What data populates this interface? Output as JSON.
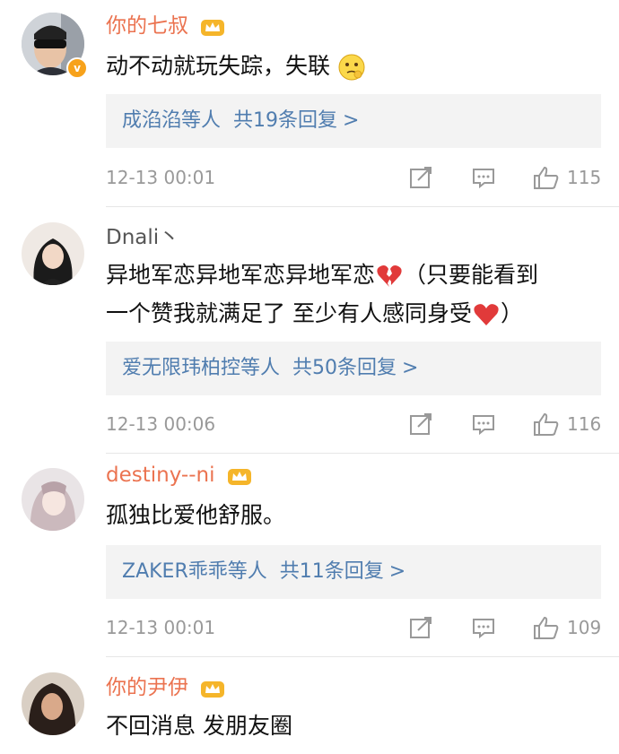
{
  "comments": [
    {
      "username": "你的七叔",
      "verified": true,
      "crown": true,
      "text": "动不动就玩失踪，失联",
      "emoji": "thinking-emoji",
      "replies_names": "成淊淊等人",
      "replies_count": "共19条回复",
      "replies_arrow": ">",
      "time": "12-13 00:01",
      "likes": "115"
    },
    {
      "username": "Dnali丶",
      "verified": false,
      "crown": false,
      "text_line1": "异地军恋异地军恋异地军恋",
      "text_line1_tail": "（只要能看到",
      "text_line2": "一个赞我就满足了 至少有人感同身受",
      "text_line2_tail": "）",
      "replies_names": "爱无限玮柏控等人",
      "replies_count": "共50条回复",
      "replies_arrow": ">",
      "time": "12-13 00:06",
      "likes": "116"
    },
    {
      "username": "destiny--ni",
      "verified": false,
      "crown": true,
      "text": "孤独比爱他舒服。",
      "replies_names": "ZAKER乖乖等人",
      "replies_count": "共11条回复",
      "replies_arrow": ">",
      "time": "12-13 00:01",
      "likes": "109"
    },
    {
      "username": "你的尹伊",
      "verified": false,
      "crown": true,
      "text": "不回消息 发朋友圈"
    }
  ],
  "colors": {
    "username": "#eb7350",
    "link": "#507daf",
    "meta": "#999999",
    "reply_bg": "#f3f3f3"
  }
}
